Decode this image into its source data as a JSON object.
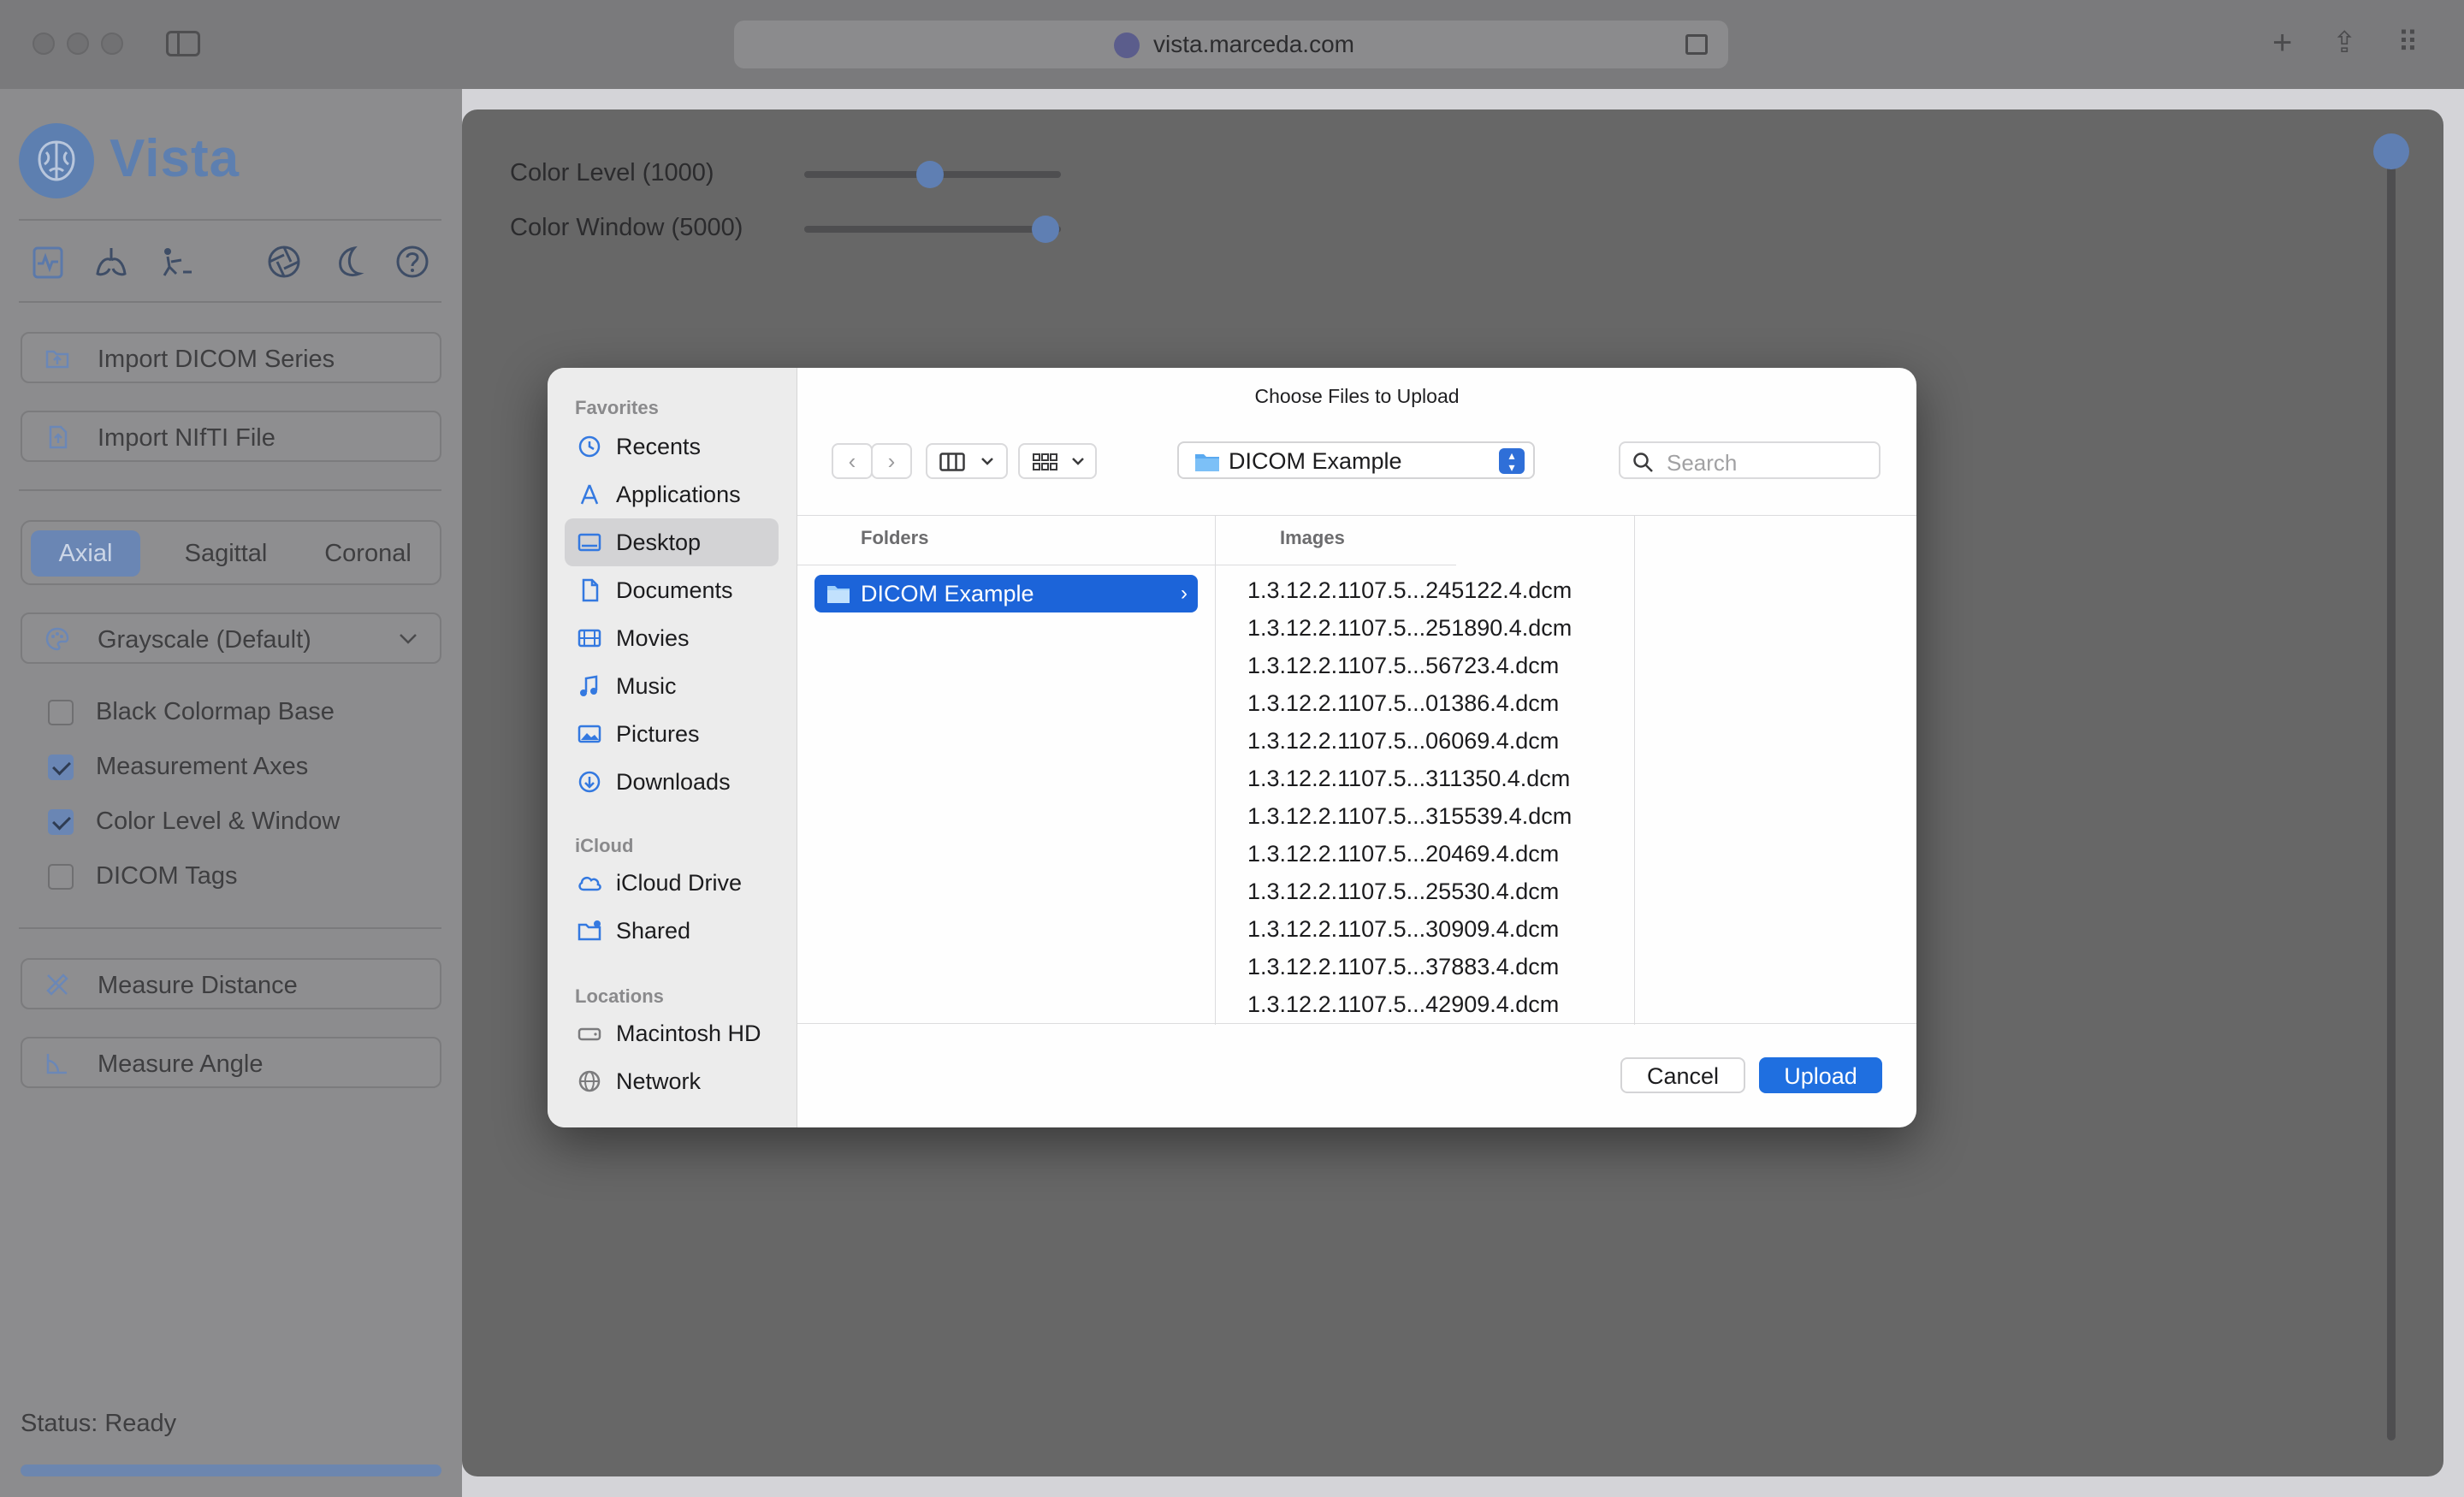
{
  "browser": {
    "url": "vista.marceda.com",
    "icons": [
      "sidebar-toggle-icon",
      "reader-icon",
      "new-tab-icon",
      "share-icon",
      "tab-overview-icon"
    ]
  },
  "app": {
    "name": "Vista",
    "accent": "#6a86b4",
    "toolbar_icons": [
      "heart-monitor-icon",
      "lungs-icon",
      "skeleton-icon",
      "aperture-icon",
      "moon-icon",
      "help-icon"
    ],
    "buttons": {
      "import_dicom": "Import DICOM Series",
      "import_nifti": "Import NIfTI File",
      "measure_distance": "Measure Distance",
      "measure_angle": "Measure Angle"
    },
    "views": [
      "Axial",
      "Sagittal",
      "Coronal"
    ],
    "active_view": "Axial",
    "colormap": "Grayscale (Default)",
    "checkboxes": [
      {
        "label": "Black Colormap Base",
        "checked": false
      },
      {
        "label": "Measurement Axes",
        "checked": true
      },
      {
        "label": "Color Level & Window",
        "checked": true
      },
      {
        "label": "DICOM Tags",
        "checked": false
      }
    ],
    "status": "Status: Ready"
  },
  "viewer": {
    "color_level_label": "Color Level (1000)",
    "color_level_fraction": 0.49,
    "color_window_label": "Color Window (5000)",
    "color_window_fraction": 0.94,
    "slice_fraction": 0.0
  },
  "dialog": {
    "title": "Choose Files to Upload",
    "sidebar": {
      "favorites_heading": "Favorites",
      "favorites": [
        "Recents",
        "Applications",
        "Desktop",
        "Documents",
        "Movies",
        "Music",
        "Pictures",
        "Downloads"
      ],
      "selected": "Desktop",
      "icloud_heading": "iCloud",
      "icloud": [
        "iCloud Drive",
        "Shared"
      ],
      "locations_heading": "Locations",
      "locations": [
        "Macintosh HD",
        "Network"
      ]
    },
    "location": "DICOM Example",
    "search_placeholder": "Search",
    "columns": {
      "folders": "Folders",
      "images": "Images"
    },
    "folders": [
      "DICOM Example"
    ],
    "images": [
      "1.3.12.2.1107.5...245122.4.dcm",
      "1.3.12.2.1107.5...251890.4.dcm",
      "1.3.12.2.1107.5...56723.4.dcm",
      "1.3.12.2.1107.5...01386.4.dcm",
      "1.3.12.2.1107.5...06069.4.dcm",
      "1.3.12.2.1107.5...311350.4.dcm",
      "1.3.12.2.1107.5...315539.4.dcm",
      "1.3.12.2.1107.5...20469.4.dcm",
      "1.3.12.2.1107.5...25530.4.dcm",
      "1.3.12.2.1107.5...30909.4.dcm",
      "1.3.12.2.1107.5...37883.4.dcm",
      "1.3.12.2.1107.5...42909.4.dcm"
    ],
    "cancel": "Cancel",
    "upload": "Upload"
  }
}
